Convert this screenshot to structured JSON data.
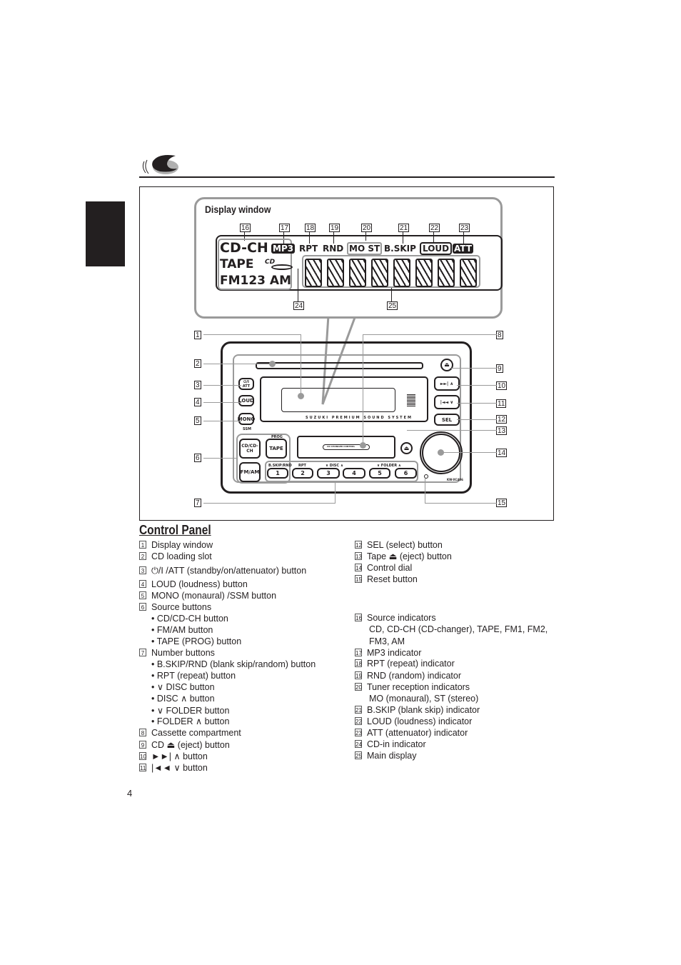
{
  "page": {
    "number": "4",
    "section_title": "Control Panel"
  },
  "figure": {
    "display_window": {
      "title": "Display window",
      "indicators": {
        "source_top": "CD-CH",
        "source_mid": "TAPE",
        "source_bottom": "FM123 AM",
        "mp3": "MP3",
        "rpt": "RPT",
        "rnd": "RND",
        "mo_st": "MO ST",
        "bskip": "B.SKIP",
        "loud": "LOUD",
        "att": "ATT",
        "cd_in": "CD"
      },
      "callouts": [
        "16",
        "17",
        "18",
        "19",
        "20",
        "21",
        "22",
        "23",
        "24",
        "25"
      ]
    },
    "device": {
      "buttons": {
        "power_att": "⏻/I ATT",
        "loud": "LOUD",
        "mono": "MONO",
        "ssm": "SSM",
        "cd_cdch": "CD/CD-CH",
        "tape": "TAPE",
        "prog": "PROG",
        "fm_am": "FM/AM",
        "sel": "SEL",
        "next": "►►| ∧",
        "prev": "|◄◄ ∨",
        "eject": "⏏"
      },
      "number_buttons": [
        "1",
        "2",
        "3",
        "4",
        "5",
        "6"
      ],
      "number_labels": [
        "B.SKIP/RND",
        "RPT",
        "∨  DISC  ∧",
        "∨  FOLDER  ∧"
      ],
      "brand_text": "SUZUKI PREMIUM SOUND SYSTEM",
      "cassette_label": "CD CHANGER CONTROL",
      "model": "KW-XC406",
      "callouts": [
        "1",
        "2",
        "3",
        "4",
        "5",
        "6",
        "7",
        "8",
        "9",
        "10",
        "11",
        "12",
        "13",
        "14",
        "15"
      ]
    }
  },
  "legend_left": [
    {
      "num": "1",
      "text": "Display window"
    },
    {
      "num": "2",
      "text": "CD loading slot"
    },
    {
      "num": "3",
      "text": "⏻/I /ATT (standby/on/attenuator) button"
    },
    {
      "num": "4",
      "text": "LOUD (loudness) button"
    },
    {
      "num": "5",
      "text": "MONO (monaural) /SSM button"
    },
    {
      "num": "6",
      "text": "Source buttons"
    },
    {
      "num": "",
      "text": "• CD/CD-CH button"
    },
    {
      "num": "",
      "text": "• FM/AM button"
    },
    {
      "num": "",
      "text": "• TAPE (PROG) button"
    },
    {
      "num": "7",
      "text": "Number buttons"
    },
    {
      "num": "",
      "text": "• B.SKIP/RND (blank skip/random) button"
    },
    {
      "num": "",
      "text": "• RPT (repeat) button"
    },
    {
      "num": "",
      "text": "• ∨ DISC button"
    },
    {
      "num": "",
      "text": "• DISC ∧ button"
    },
    {
      "num": "",
      "text": "• ∨ FOLDER button"
    },
    {
      "num": "",
      "text": "• FOLDER ∧ button"
    },
    {
      "num": "8",
      "text": "Cassette compartment"
    },
    {
      "num": "9",
      "text": "CD ⏏ (eject) button"
    },
    {
      "num": "10",
      "text": "►►| ∧ button"
    },
    {
      "num": "11",
      "text": "|◄◄ ∨ button"
    }
  ],
  "legend_right": [
    {
      "num": "12",
      "text": "SEL (select) button"
    },
    {
      "num": "13",
      "text": "Tape ⏏ (eject) button"
    },
    {
      "num": "14",
      "text": "Control dial"
    },
    {
      "num": "15",
      "text": "Reset button"
    },
    {
      "num": "16",
      "text": "Source indicators"
    },
    {
      "num": "",
      "text": "CD, CD-CH (CD-changer), TAPE, FM1, FM2,"
    },
    {
      "num": "",
      "text": "FM3, AM"
    },
    {
      "num": "17",
      "text": "MP3 indicator"
    },
    {
      "num": "18",
      "text": "RPT (repeat) indicator"
    },
    {
      "num": "19",
      "text": "RND (random) indicator"
    },
    {
      "num": "20",
      "text": "Tuner reception indicators"
    },
    {
      "num": "",
      "text": "MO (monaural), ST (stereo)"
    },
    {
      "num": "21",
      "text": "B.SKIP (blank skip) indicator"
    },
    {
      "num": "22",
      "text": "LOUD (loudness) indicator"
    },
    {
      "num": "23",
      "text": "ATT (attenuator) indicator"
    },
    {
      "num": "24",
      "text": "CD-in indicator"
    },
    {
      "num": "25",
      "text": "Main display"
    }
  ]
}
